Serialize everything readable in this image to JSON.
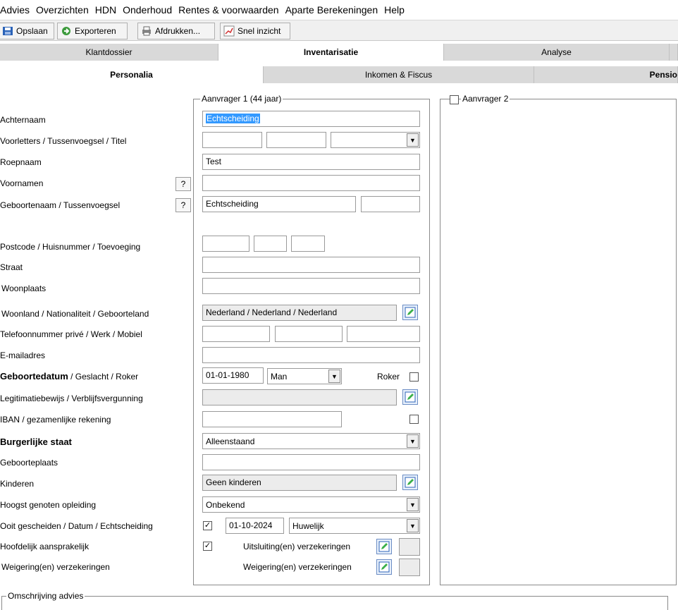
{
  "menu": [
    "Advies",
    "Overzichten",
    "HDN",
    "Onderhoud",
    "Rentes & voorwaarden",
    "Aparte Berekeningen",
    "Help"
  ],
  "toolbar": {
    "save": "Opslaan",
    "export": "Exporteren",
    "print": "Afdrukken...",
    "quick": "Snel inzicht"
  },
  "tabs_main": [
    "Klantdossier",
    "Inventarisatie",
    "Analyse"
  ],
  "tabs_sub": [
    "Personalia",
    "Inkomen & Fiscus",
    "Pensio"
  ],
  "group1_label": "Aanvrager 1 (44 jaar)",
  "group2_label": "Aanvrager 2",
  "labels": {
    "achternaam": "Achternaam",
    "voorletters": "Voorletters / Tussenvoegsel / Titel",
    "roepnaam": "Roepnaam",
    "voornamen": "Voornamen",
    "geboortenaam": "Geboortenaam / Tussenvoegsel",
    "postcode": "Postcode / Huisnummer / Toevoeging",
    "straat": "Straat",
    "woonplaats": "Woonplaats",
    "woonland": "Woonland / Nationaliteit / Geboorteland",
    "telefoon": "Telefoonnummer privé / Werk / Mobiel",
    "email": "E-mailadres",
    "geboortedatum_bold": "Geboortedatum",
    "geboortedatum_rest": " / Geslacht / Roker",
    "legitimatie": "Legitimatiebewijs / Verblijfsvergunning",
    "iban": "IBAN / gezamenlijke rekening",
    "burgerlijke": "Burgerlijke staat",
    "geboorteplaats": "Geboorteplaats",
    "kinderen": "Kinderen",
    "opleiding": "Hoogst genoten opleiding",
    "gescheiden": "Ooit gescheiden / Datum / Echtscheiding",
    "hoofdelijk": "Hoofdelijk aansprakelijk",
    "weigering": "Weigering(en) verzekeringen",
    "roker": "Roker",
    "uitsluiting": "Uitsluiting(en) verzekeringen",
    "weigering_inline": "Weigering(en) verzekeringen",
    "omschrijving": "Omschrijving advies"
  },
  "values": {
    "achternaam": "Echtscheiding",
    "roepnaam": "Test",
    "geboortenaam": "Echtscheiding",
    "woonland": "Nederland / Nederland / Nederland",
    "geboortedatum": "01-01-1980",
    "geslacht": "Man",
    "burgerlijke": "Alleenstaand",
    "kinderen": "Geen kinderen",
    "opleiding": "Onbekend",
    "scheidingsdatum": "01-10-2024",
    "echtscheiding": "Huwelijk",
    "qmark": "?"
  }
}
